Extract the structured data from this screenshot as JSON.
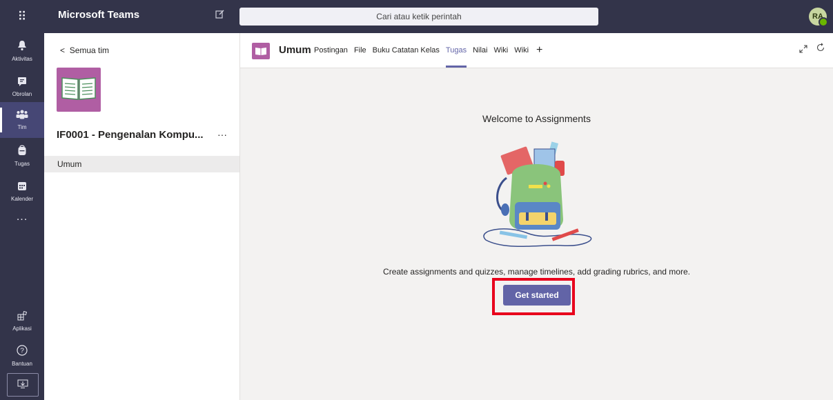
{
  "app": {
    "name": "Microsoft Teams"
  },
  "search": {
    "placeholder": "Cari atau ketik perintah"
  },
  "user": {
    "initials": "RA"
  },
  "rail": {
    "items": [
      {
        "label": "Aktivitas",
        "icon": "bell-icon"
      },
      {
        "label": "Obrolan",
        "icon": "chat-icon"
      },
      {
        "label": "Tim",
        "icon": "teams-icon",
        "active": true
      },
      {
        "label": "Tugas",
        "icon": "backpack-icon"
      },
      {
        "label": "Kalender",
        "icon": "calendar-icon"
      }
    ],
    "more": "...",
    "apps_label": "Aplikasi",
    "help_label": "Bantuan"
  },
  "sidebar": {
    "back": "Semua tim",
    "team_name": "IF0001 - Pengenalan Kompu...",
    "more": "···",
    "channels": [
      "Umum"
    ]
  },
  "channel": {
    "name": "Umum",
    "tabs": [
      {
        "label": "Postingan"
      },
      {
        "label": "File"
      },
      {
        "label": "Buku Catatan Kelas"
      },
      {
        "label": "Tugas",
        "active": true
      },
      {
        "label": "Nilai"
      },
      {
        "label": "Wiki"
      },
      {
        "label": "Wiki"
      }
    ]
  },
  "content": {
    "title": "Welcome to Assignments",
    "description": "Create assignments and quizzes, manage timelines, add grading rubrics, and more.",
    "button": "Get started"
  },
  "colors": {
    "rail": "#33344a",
    "accent": "#6264a7",
    "team": "#b05ea3",
    "highlight": "#e8001c"
  }
}
